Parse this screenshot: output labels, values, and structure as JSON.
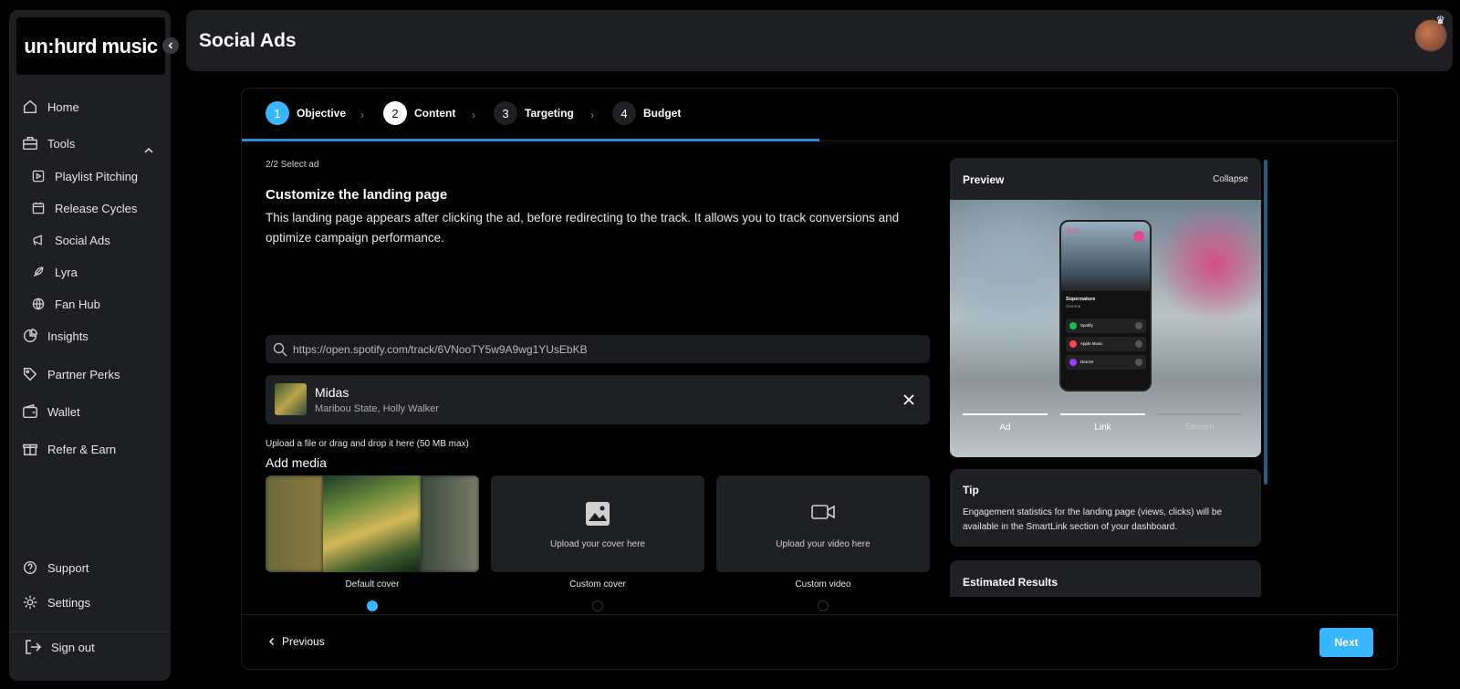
{
  "sidebar": {
    "logo": "un:hurd music",
    "items": [
      {
        "label": "Home"
      },
      {
        "label": "Tools"
      },
      {
        "label": "Playlist Pitching"
      },
      {
        "label": "Release Cycles"
      },
      {
        "label": "Social Ads"
      },
      {
        "label": "Lyra"
      },
      {
        "label": "Fan Hub"
      },
      {
        "label": "Insights"
      },
      {
        "label": "Partner Perks"
      },
      {
        "label": "Wallet"
      },
      {
        "label": "Refer & Earn"
      }
    ],
    "support": "Support",
    "settings": "Settings",
    "signout": "Sign out"
  },
  "header": {
    "title": "Social Ads"
  },
  "steps": [
    {
      "num": "1",
      "label": "Objective"
    },
    {
      "num": "2",
      "label": "Content"
    },
    {
      "num": "3",
      "label": "Targeting"
    },
    {
      "num": "4",
      "label": "Budget"
    }
  ],
  "progress_fraction": 0.5,
  "content": {
    "substep": "2/2 Select ad",
    "title": "Customize the landing page",
    "description": "This landing page appears after clicking the ad, before redirecting to the track. It allows you to track conversions and optimize campaign performance.",
    "search_value": "https://open.spotify.com/track/6VNooTY5w9A9wg1YUsEbKB",
    "track": {
      "title": "Midas",
      "artist": "Maribou State, Holly Walker"
    },
    "upload_hint": "Upload a file or drag and drop it here (50 MB max)",
    "add_media": "Add media",
    "media": [
      {
        "label": "Default cover",
        "selected": true
      },
      {
        "label": "Custom cover",
        "placeholder": "Upload your cover here",
        "selected": false
      },
      {
        "label": "Custom video",
        "placeholder": "Upload your video here",
        "selected": false
      }
    ]
  },
  "preview": {
    "title": "Preview",
    "collapse": "Collapse",
    "phone": {
      "song": "Supernature",
      "artist": "Cerrone",
      "platforms": [
        "Spotify",
        "Apple Music",
        "Deezer"
      ]
    },
    "tabs": [
      "Ad",
      "Link",
      "Stream"
    ]
  },
  "tip": {
    "title": "Tip",
    "text": "Engagement statistics for the landing page (views, clicks) will be available in the SmartLink section of your dashboard."
  },
  "estimated": {
    "title": "Estimated Results"
  },
  "footer": {
    "previous": "Previous",
    "next": "Next"
  },
  "colors": {
    "accent": "#38b6ff",
    "panel": "#1f2024",
    "sidebar": "#1e1f22"
  }
}
